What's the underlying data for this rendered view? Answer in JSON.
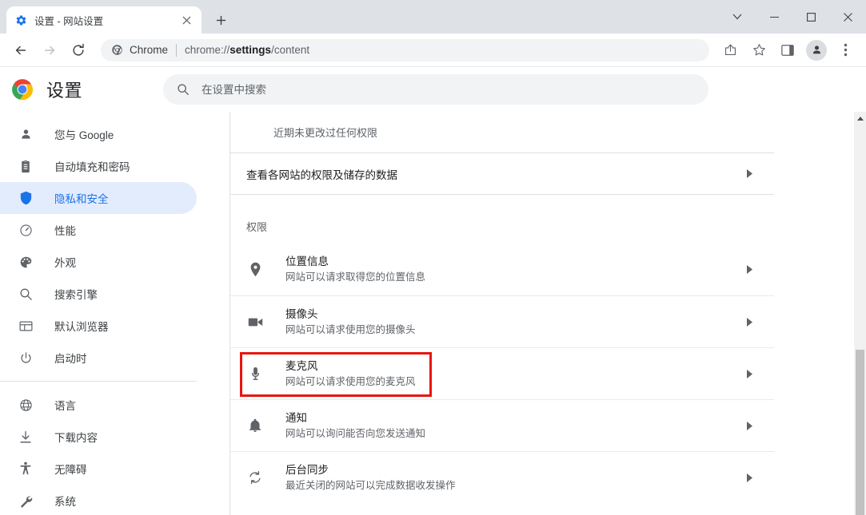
{
  "window": {
    "tab": {
      "title": "设置 - 网站设置",
      "favicon": "gear-icon",
      "close": "×"
    },
    "new_tab": "+",
    "controls": {
      "tab_search": "⌄",
      "minimize": "—",
      "maximize": "▢",
      "close": "✕"
    }
  },
  "toolbar": {
    "back": "←",
    "forward": "→",
    "reload": "⟳",
    "omnibox": {
      "scheme_label": "Chrome",
      "url_prefix": "chrome://",
      "url_bold": "settings",
      "url_suffix": "/content"
    },
    "share": "share-icon",
    "bookmark": "star-icon",
    "side_panel": "side-panel-icon",
    "profile": "avatar-icon",
    "menu": "three-dot-menu-icon"
  },
  "settings": {
    "title": "设置",
    "search_placeholder": "在设置中搜索",
    "search_value": ""
  },
  "sidebar": {
    "items": [
      {
        "label": "您与 Google",
        "icon": "person-icon",
        "selected": false
      },
      {
        "label": "自动填充和密码",
        "icon": "clipboard-icon",
        "selected": false
      },
      {
        "label": "隐私和安全",
        "icon": "shield-icon",
        "selected": true
      },
      {
        "label": "性能",
        "icon": "speedometer-icon",
        "selected": false
      },
      {
        "label": "外观",
        "icon": "palette-icon",
        "selected": false
      },
      {
        "label": "搜索引擎",
        "icon": "search-icon",
        "selected": false
      },
      {
        "label": "默认浏览器",
        "icon": "browser-window-icon",
        "selected": false
      },
      {
        "label": "启动时",
        "icon": "power-icon",
        "selected": false
      }
    ],
    "items2": [
      {
        "label": "语言",
        "icon": "globe-icon",
        "selected": false
      },
      {
        "label": "下载内容",
        "icon": "download-icon",
        "selected": false
      },
      {
        "label": "无障碍",
        "icon": "accessibility-icon",
        "selected": false
      },
      {
        "label": "系统",
        "icon": "wrench-icon",
        "selected": false
      }
    ]
  },
  "content": {
    "recent_activity_note": "近期未更改过任何权限",
    "all_sites_link": "查看各网站的权限及储存的数据",
    "permissions_heading": "权限",
    "permissions": [
      {
        "title": "位置信息",
        "subtitle": "网站可以请求取得您的位置信息",
        "icon": "location-pin-icon",
        "highlighted": false
      },
      {
        "title": "摄像头",
        "subtitle": "网站可以请求使用您的摄像头",
        "icon": "camera-icon",
        "highlighted": false
      },
      {
        "title": "麦克风",
        "subtitle": "网站可以请求使用您的麦克风",
        "icon": "microphone-icon",
        "highlighted": true
      },
      {
        "title": "通知",
        "subtitle": "网站可以询问能否向您发送通知",
        "icon": "bell-icon",
        "highlighted": false
      },
      {
        "title": "后台同步",
        "subtitle": "最近关闭的网站可以完成数据收发操作",
        "icon": "sync-icon",
        "highlighted": false
      }
    ],
    "row_arrow": "▶"
  },
  "colors": {
    "accent": "#1a73e8",
    "selected_pill": "#e3ecfd",
    "highlight_red": "#e8150f",
    "titlebar": "#dee1e6",
    "text_primary": "#202124",
    "text_secondary": "#5f6368"
  }
}
